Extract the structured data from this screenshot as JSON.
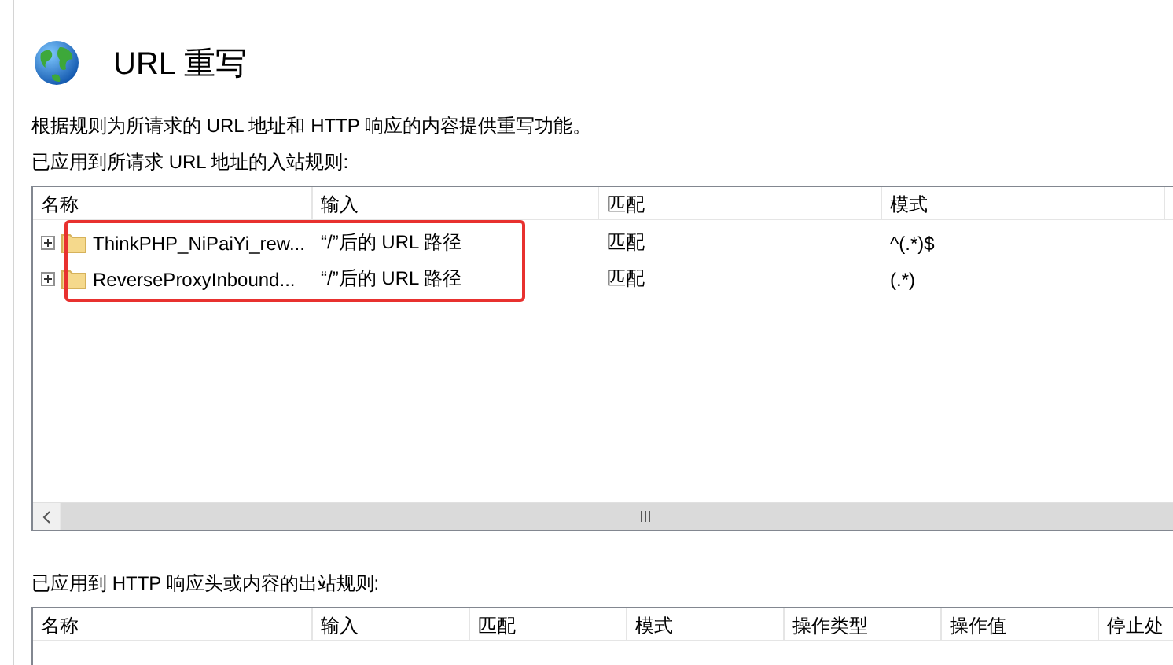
{
  "title": "URL 重写",
  "description": "根据规则为所请求的 URL 地址和 HTTP 响应的内容提供重写功能。",
  "inbound": {
    "label": "已应用到所请求 URL 地址的入站规则:",
    "columns": [
      "名称",
      "输入",
      "匹配",
      "模式"
    ],
    "rows": [
      {
        "name": "ThinkPHP_NiPaiYi_rew...",
        "input": "“/”后的 URL 路径",
        "match": "匹配",
        "pattern": "^(.*)$",
        "expanded": false,
        "highlighted": true
      },
      {
        "name": "ReverseProxyInbound...",
        "input": "“/”后的 URL 路径",
        "match": "匹配",
        "pattern": "(.*)",
        "expanded": false,
        "highlighted": true
      }
    ]
  },
  "outbound": {
    "label": "已应用到 HTTP 响应头或内容的出站规则:",
    "columns": [
      "名称",
      "输入",
      "匹配",
      "模式",
      "操作类型",
      "操作值",
      "停止处"
    ]
  }
}
